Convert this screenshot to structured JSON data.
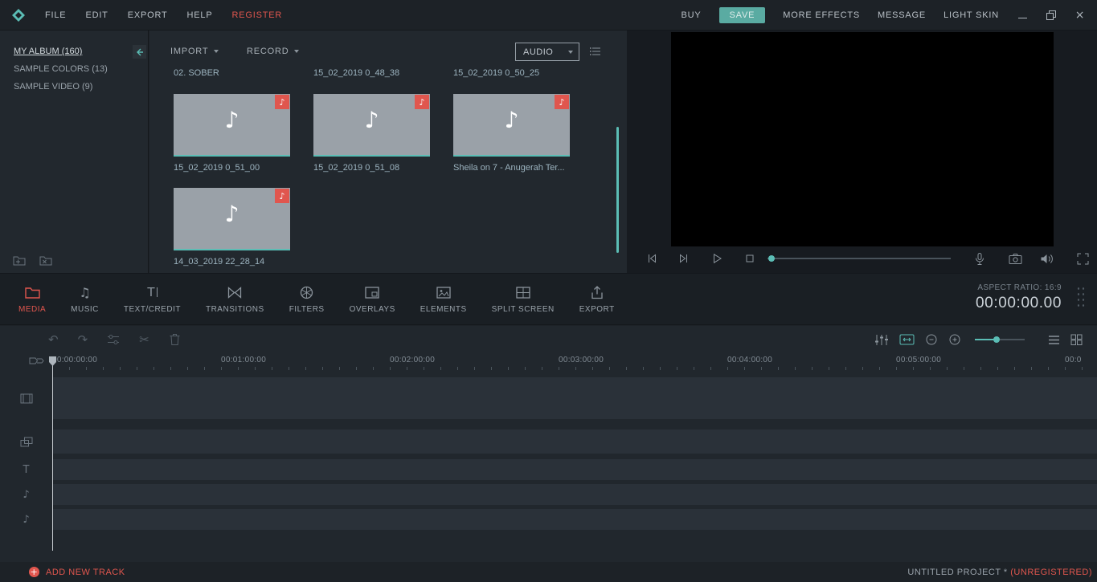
{
  "window": {
    "menu": [
      {
        "label": "FILE"
      },
      {
        "label": "EDIT"
      },
      {
        "label": "EXPORT"
      },
      {
        "label": "HELP"
      }
    ],
    "register": "REGISTER",
    "buy": "BUY",
    "save": "SAVE",
    "more_effects": "MORE EFFECTS",
    "message": "MESSAGE",
    "light_skin": "LIGHT SKIN"
  },
  "sidebar": {
    "albums": [
      {
        "label": "MY ALBUM (160)"
      },
      {
        "label": "SAMPLE COLORS (13)"
      },
      {
        "label": "SAMPLE VIDEO (9)"
      }
    ]
  },
  "media": {
    "import_label": "IMPORT",
    "record_label": "RECORD",
    "filter_value": "AUDIO",
    "top_row_labels": [
      "02. SOBER",
      "15_02_2019 0_48_38",
      "15_02_2019 0_50_25"
    ],
    "clips": [
      {
        "name": "15_02_2019 0_51_00"
      },
      {
        "name": "15_02_2019 0_51_08"
      },
      {
        "name": "Sheila on 7 - Anugerah Ter..."
      },
      {
        "name": "14_03_2019 22_28_14"
      }
    ]
  },
  "preview": {
    "aspect_ratio_label": "ASPECT RATIO: 16:9",
    "timecode": "00:00:00.00"
  },
  "tabs": [
    {
      "label": "MEDIA"
    },
    {
      "label": "MUSIC"
    },
    {
      "label": "TEXT/CREDIT"
    },
    {
      "label": "TRANSITIONS"
    },
    {
      "label": "FILTERS"
    },
    {
      "label": "OVERLAYS"
    },
    {
      "label": "ELEMENTS"
    },
    {
      "label": "SPLIT SCREEN"
    },
    {
      "label": "EXPORT"
    }
  ],
  "timeline": {
    "ruler_labels": [
      "00:00:00:00",
      "00:01:00:00",
      "00:02:00:00",
      "00:03:00:00",
      "00:04:00:00",
      "00:05:00:00",
      "00:0"
    ],
    "add_new_track": "ADD NEW TRACK",
    "project_name": "UNTITLED PROJECT * ",
    "unregistered": "(UNREGISTERED)"
  },
  "colors": {
    "teal": "#5bbdb5",
    "coral": "#e0564e"
  },
  "icons": {
    "note": "♪",
    "double_note": "♫",
    "undo": "↶",
    "redo": "↷",
    "scissors": "✂",
    "letter_t": "T",
    "close": "×",
    "plus": "+"
  }
}
